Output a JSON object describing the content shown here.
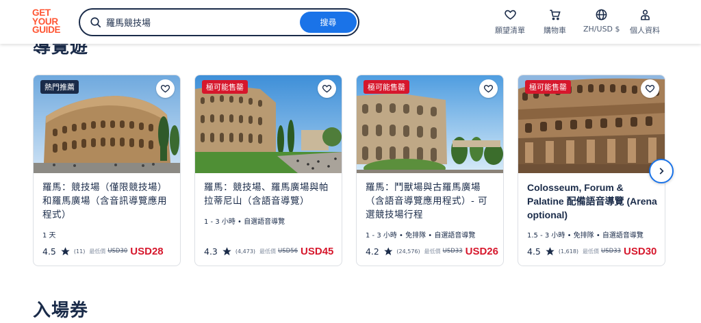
{
  "header": {
    "logo": [
      "GET",
      "YOUR",
      "GUIDE"
    ],
    "search_value": "羅馬競技場",
    "search_button": "搜尋",
    "nav": [
      {
        "icon": "heart-icon",
        "label": "願望清單"
      },
      {
        "icon": "cart-icon",
        "label": "購物車"
      },
      {
        "icon": "globe-icon",
        "label": "ZH/USD $"
      },
      {
        "icon": "user-icon",
        "label": "個人資料"
      }
    ]
  },
  "sections": {
    "tours_title": "導覽遊",
    "tickets_title": "入場券"
  },
  "colors": {
    "brand": "#ff5533",
    "navy": "#1a2b49",
    "blue": "#1a73e8",
    "price_red": "#d6172c"
  },
  "cards": [
    {
      "badge": "熱門推薦",
      "title": "羅馬：競技場（僅限競技場）和羅馬廣場（含音訊導覽應用程式）",
      "meta": "1 天",
      "rating": "4.5",
      "reviews": "(11)",
      "price_label": "最低價",
      "old_price": "USD30",
      "price": "USD28"
    },
    {
      "badge": "極可能售罄",
      "title": "羅馬：競技場、羅馬廣場與帕拉蒂尼山（含語音導覽）",
      "meta": "1 - 3 小時 • 自選語音導覽",
      "rating": "4.3",
      "reviews": "(4,473)",
      "price_label": "最低價",
      "old_price": "USD56",
      "price": "USD45"
    },
    {
      "badge": "極可能售罄",
      "title": "羅馬：鬥獸場與古羅馬廣場（含語音導覽應用程式）- 可選競技場行程",
      "meta": "1 - 3 小時 • 免排隊 • 自選語音導覽",
      "rating": "4.2",
      "reviews": "(24,576)",
      "price_label": "最低價",
      "old_price": "USD33",
      "price": "USD26"
    },
    {
      "badge": "極可能售罄",
      "title": "Colosseum, Forum & Palatine 配備語音導覽 (Arena optional)",
      "meta": "1.5 - 3 小時 • 免排隊 • 自選語音導覽",
      "rating": "4.5",
      "reviews": "(1,618)",
      "price_label": "最低價",
      "old_price": "USD33",
      "price": "USD30"
    }
  ]
}
